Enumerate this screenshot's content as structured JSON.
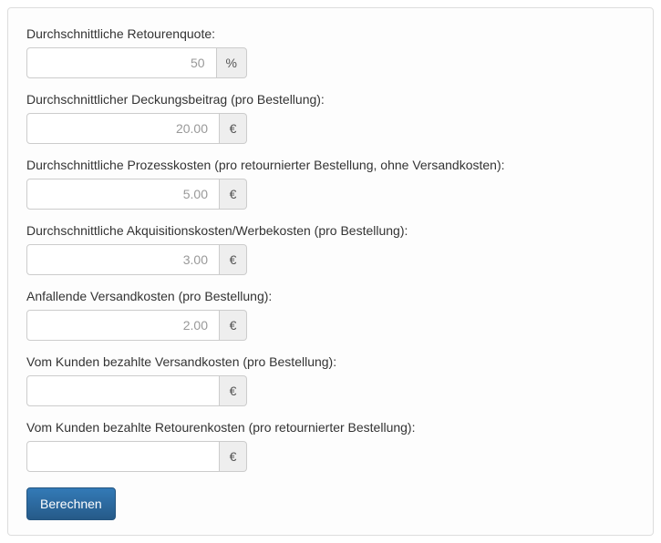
{
  "form": {
    "fields": [
      {
        "label": "Durchschnittliche Retourenquote:",
        "placeholder": "50",
        "unit": "%"
      },
      {
        "label": "Durchschnittlicher Deckungsbeitrag (pro Bestellung):",
        "placeholder": "20.00",
        "unit": "€"
      },
      {
        "label": "Durchschnittliche Prozesskosten (pro retournierter Bestellung, ohne Versandkosten):",
        "placeholder": "5.00",
        "unit": "€"
      },
      {
        "label": "Durchschnittliche Akquisitionskosten/Werbekosten (pro Bestellung):",
        "placeholder": "3.00",
        "unit": "€"
      },
      {
        "label": "Anfallende Versandkosten (pro Bestellung):",
        "placeholder": "2.00",
        "unit": "€"
      },
      {
        "label": "Vom Kunden bezahlte Versandkosten (pro Bestellung):",
        "placeholder": "",
        "unit": "€"
      },
      {
        "label": "Vom Kunden bezahlte Retourenkosten (pro retournierter Bestellung):",
        "placeholder": "",
        "unit": "€"
      }
    ],
    "submit_label": "Berechnen"
  }
}
